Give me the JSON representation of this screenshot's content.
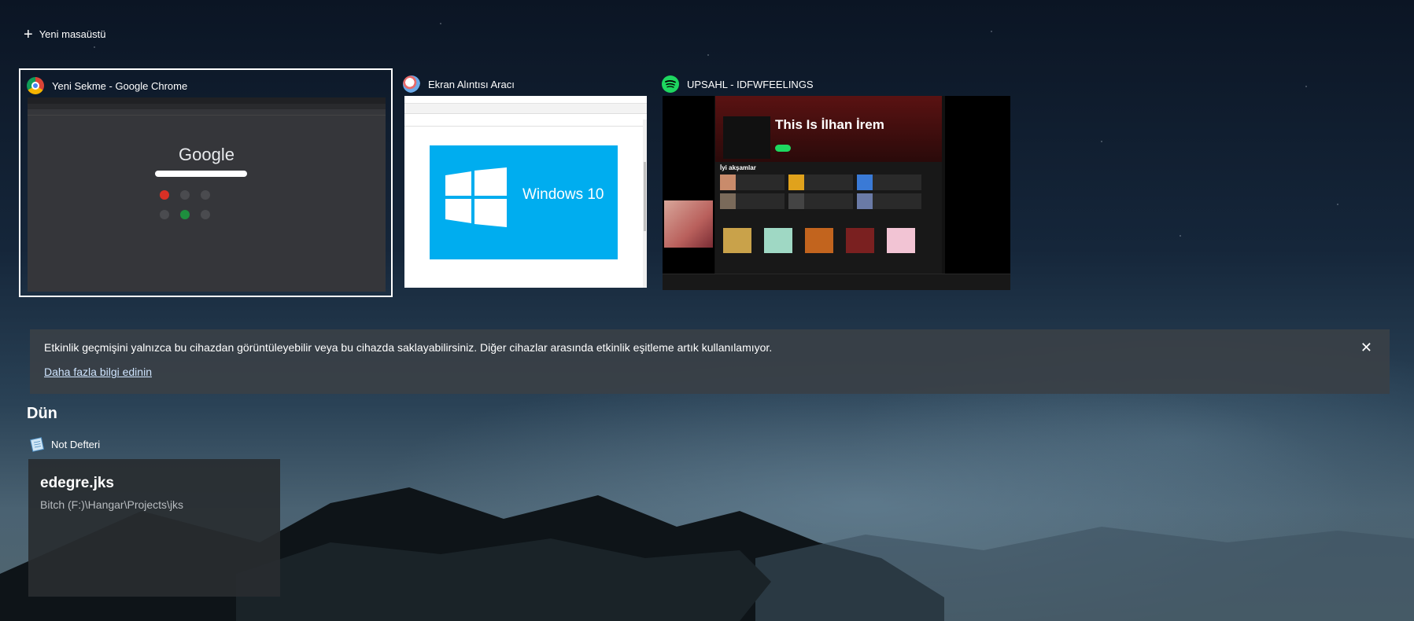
{
  "new_desktop": {
    "label": "Yeni masaüstü"
  },
  "windows": [
    {
      "title": "Yeni Sekme - Google Chrome",
      "app": "chrome",
      "icon": "chrome-icon"
    },
    {
      "title": "Ekran Alıntısı Aracı",
      "app": "snipping-tool",
      "icon": "snipping-tool-icon"
    },
    {
      "title": "UPSAHL - IDFWFEELINGS",
      "app": "spotify",
      "icon": "spotify-icon"
    }
  ],
  "chrome_preview": {
    "logo": "Google"
  },
  "snip_preview": {
    "image_text": "Windows 10"
  },
  "spotify_preview": {
    "hero_title": "This Is İlhan İrem",
    "section_title": "İyi akşamlar"
  },
  "banner": {
    "message": "Etkinlik geçmişini yalnızca bu cihazdan görüntüleyebilir veya bu cihazda saklayabilirsiniz. Diğer cihazlar arasında etkinlik eşitleme artık kullanılamıyor.",
    "link": "Daha fazla bilgi edinin",
    "close_icon": "close-icon"
  },
  "timeline": {
    "day": "Dün",
    "groups": [
      {
        "app_name": "Not Defteri",
        "icon": "notepad-icon",
        "activities": [
          {
            "title": "edegre.jks",
            "path": "Bitch (F:)\\Hangar\\Projects\\jks"
          }
        ]
      }
    ]
  },
  "colors": {
    "selection_border": "#ffffff",
    "spotify_green": "#1ed760",
    "windows_blue": "#00adef",
    "banner_bg": "#3a4046"
  }
}
